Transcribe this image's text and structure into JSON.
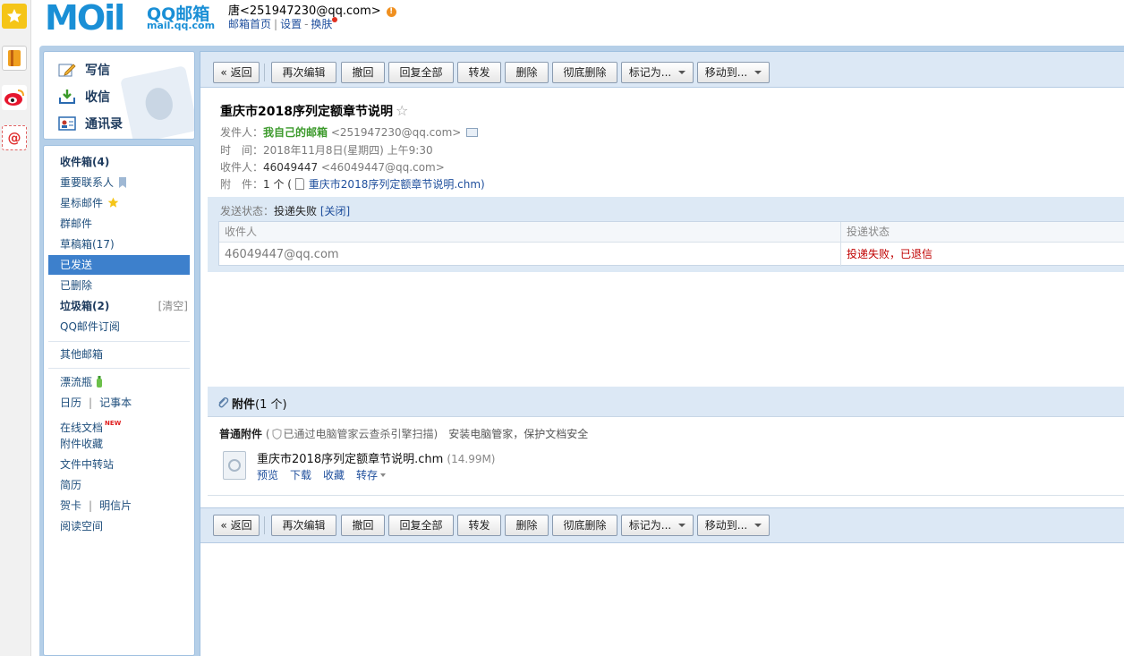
{
  "header": {
    "logo_text": "MOil",
    "logo_product": "QQ邮箱",
    "logo_url": "mail.qq.com",
    "user": "唐<251947230@qq.com>",
    "links": [
      "邮箱首页",
      "设置",
      "换肤"
    ],
    "link_separator": "|",
    "dash": "-"
  },
  "left_nav": {
    "write": "写信",
    "receive": "收信",
    "contacts": "通讯录"
  },
  "folders": {
    "inbox": "收件箱(4)",
    "important_contacts": "重要联系人",
    "starred": "星标邮件",
    "group": "群邮件",
    "drafts": "草稿箱(17)",
    "sent": "已发送",
    "deleted": "已删除",
    "spam": "垃圾箱(2)",
    "spam_clear": "[清空]",
    "subscriptions": "QQ邮件订阅",
    "other_mailbox": "其他邮箱",
    "drift_bottle": "漂流瓶",
    "calendar": "日历",
    "notepad": "记事本",
    "online_docs": "在线文档",
    "new_tag": "NEW",
    "attachment_favorites": "附件收藏",
    "file_transfer": "文件中转站",
    "resume": "简历",
    "greeting_card": "贺卡",
    "postcard": "明信片",
    "reading_space": "阅读空间",
    "separator": "|"
  },
  "toolbar": {
    "back": "« 返回",
    "edit_again": "再次编辑",
    "recall": "撤回",
    "reply_all": "回复全部",
    "forward": "转发",
    "delete": "删除",
    "delete_permanently": "彻底删除",
    "mark_as": "标记为...",
    "move_to": "移动到..."
  },
  "mail": {
    "subject": "重庆市2018序列定额章节说明",
    "star": "☆",
    "from_label": "发件人：",
    "from_name": "我自己的邮箱",
    "from_addr": "<251947230@qq.com>",
    "time_label": "时　间：",
    "time_value": "2018年11月8日(星期四) 上午9:30",
    "to_label": "收件人：",
    "to_name": "46049447",
    "to_addr": "<46049447@qq.com>",
    "att_label": "附　件：",
    "att_count": "1 个 (",
    "att_name": "重庆市2018序列定额章节说明.chm",
    "att_close": ")"
  },
  "delivery": {
    "label": "发送状态：",
    "status": "投递失败",
    "close": "[关闭]",
    "col_recipient": "收件人",
    "col_status": "投递状态",
    "recipient": "46049447@qq.com",
    "result": "投递失败，已退信"
  },
  "attachments": {
    "title": "附件",
    "count": "(1 个)",
    "normal_label": "普通附件",
    "scan_text": "已通过电脑管家云查杀引擎扫描",
    "scan_open": "(",
    "scan_close": ")",
    "install_link": "安装电脑管家，保护文档安全",
    "file_name": "重庆市2018序列定额章节说明.chm",
    "file_size": "(14.99M)",
    "actions": [
      "预览",
      "下载",
      "收藏",
      "转存"
    ]
  },
  "colors": {
    "accent": "#1a8fd6",
    "toolbar_bg": "#dce8f5",
    "frame": "#b5cfe8",
    "selected": "#3d80cc",
    "fail_red": "#c00000",
    "sender_green": "#3c9a2c"
  }
}
